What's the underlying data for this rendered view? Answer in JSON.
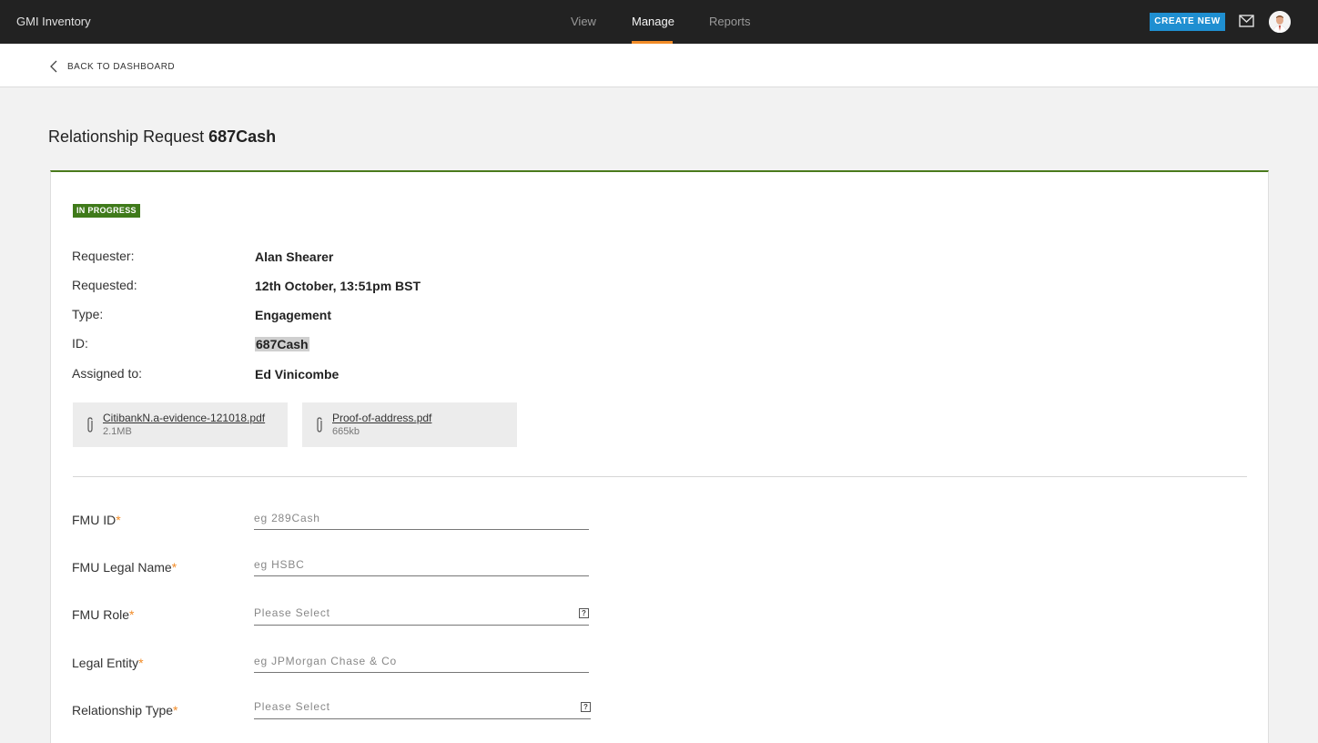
{
  "topbar": {
    "brand": "GMI Inventory",
    "nav": [
      {
        "label": "View",
        "active": false
      },
      {
        "label": "Manage",
        "active": true
      },
      {
        "label": "Reports",
        "active": false
      }
    ],
    "create_label": "CREATE NEW",
    "accent": "#f28c28",
    "button_color": "#1f8fd1"
  },
  "subbar": {
    "back_label": "BACK TO DASHBOARD"
  },
  "page": {
    "title_prefix": "Relationship Request",
    "title_id": "687Cash"
  },
  "request": {
    "status": "IN PROGRESS",
    "status_color": "#3f7a1a",
    "details": [
      {
        "label": "Requester:",
        "value": "Alan Shearer"
      },
      {
        "label": "Requested:",
        "value": "12th October, 13:51pm BST"
      },
      {
        "label": "Type:",
        "value": "Engagement"
      },
      {
        "label": "ID:",
        "value": "687Cash"
      },
      {
        "label": "Assigned to:",
        "value": "Ed Vinicombe"
      }
    ],
    "attachments": [
      {
        "name": "CitibankN.a-evidence-121018.pdf",
        "size": "2.1MB"
      },
      {
        "name": "Proof-of-address.pdf",
        "size": "665kb"
      }
    ]
  },
  "form": {
    "fields": [
      {
        "label": "FMU ID",
        "required": "*",
        "placeholder": "eg 289Cash",
        "kind": "input"
      },
      {
        "label": "FMU Legal Name",
        "required": "*",
        "placeholder": "eg HSBC",
        "kind": "input"
      },
      {
        "label": "FMU Role",
        "required": "*",
        "placeholder": "Please Select",
        "kind": "select"
      },
      {
        "label": "Legal Entity",
        "required": "*",
        "placeholder": "eg JPMorgan Chase & Co",
        "kind": "input"
      },
      {
        "label": "Relationship Type",
        "required": "*",
        "placeholder": "Please Select",
        "kind": "select"
      }
    ],
    "help_glyph": "?"
  }
}
